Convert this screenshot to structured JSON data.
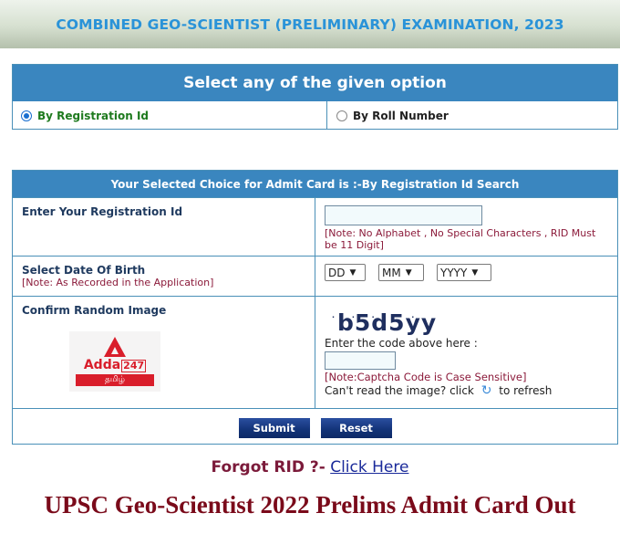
{
  "banner": {
    "title": "COMBINED GEO-SCIENTIST (PRELIMINARY) EXAMINATION, 2023"
  },
  "option_selector": {
    "header": "Select any of the given option",
    "options": [
      {
        "label": "By Registration Id",
        "selected": true
      },
      {
        "label": "By Roll Number",
        "selected": false
      }
    ]
  },
  "form": {
    "header": "Your Selected Choice for Admit Card is :-By Registration Id Search",
    "registration": {
      "label": "Enter Your Registration Id",
      "value": "",
      "note": "[Note: No Alphabet , No Special Characters , RID Must be 11 Digit]"
    },
    "dob": {
      "label": "Select Date Of Birth",
      "note": "[Note: As Recorded in the Application]",
      "day": "DD",
      "month": "MM",
      "year": "YYYY"
    },
    "captcha": {
      "label": "Confirm Random Image",
      "logo_word": "Adda",
      "logo_num": "247",
      "logo_band": "தமிழ்",
      "code_image_text": "b5d5yy",
      "dots": "· · · · ·",
      "instruction": "Enter the code above here :",
      "value": "",
      "note": "[Note:Captcha Code is Case Sensitive]",
      "refresh_prefix": "Can't read the image? click",
      "refresh_suffix": "to refresh",
      "refresh_icon": "↻"
    },
    "buttons": {
      "submit": "Submit",
      "reset": "Reset"
    }
  },
  "forgot": {
    "label": "Forgot RID ?-",
    "link": "Click Here"
  },
  "headline": "UPSC Geo-Scientist 2022 Prelims Admit Card Out",
  "colors": {
    "banner_text": "#2a93d8",
    "header_bg": "#3a86bf",
    "note_text": "#8b1a3a",
    "button_bg": "#123277",
    "headline": "#7a0a1a"
  }
}
